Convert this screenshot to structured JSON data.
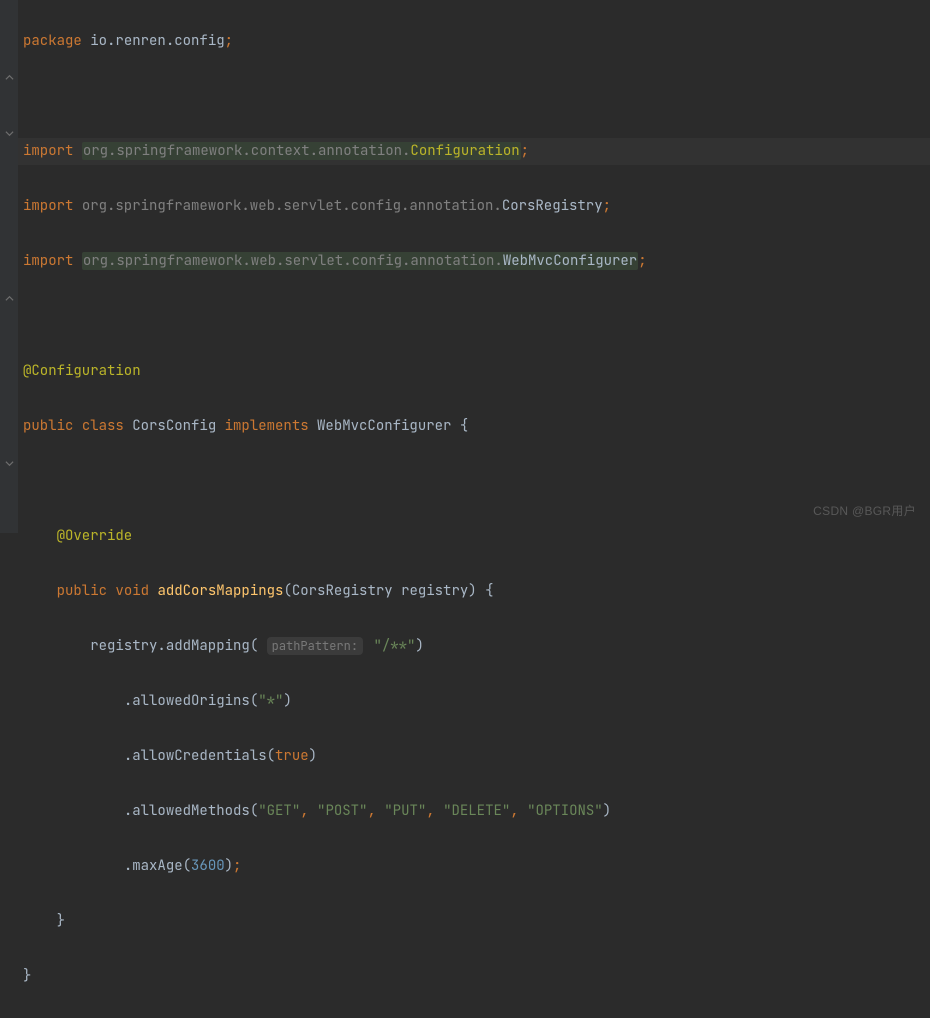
{
  "code": {
    "pkg_kw": "package",
    "pkg_path": "io.renren.config",
    "import_kw": "import",
    "imp1_pkg": "org.springframework.context.annotation.",
    "imp1_cls": "Configuration",
    "imp2_pkg": "org.springframework.web.servlet.config.annotation.",
    "imp2_cls": "CorsRegistry",
    "imp3_pkg": "org.springframework.web.servlet.config.annotation.",
    "imp3_cls": "WebMvcConfigurer",
    "ann_config": "@Configuration",
    "public_kw": "public",
    "class_kw": "class",
    "class_name": "CorsConfig",
    "implements_kw": "implements",
    "iface": "WebMvcConfigurer",
    "ann_override": "@Override",
    "void_kw": "void",
    "method_name": "addCorsMappings",
    "param_type": "CorsRegistry",
    "param_name": "registry",
    "reg_var": "registry",
    "addMapping": "addMapping",
    "hint_pathPattern": "pathPattern:",
    "str_all": "\"/**\"",
    "allowedOrigins": "allowedOrigins",
    "str_star": "\"*\"",
    "allowCredentials": "allowCredentials",
    "true_lit": "true",
    "allowedMethods": "allowedMethods",
    "str_get": "\"GET\"",
    "str_post": "\"POST\"",
    "str_put": "\"PUT\"",
    "str_delete": "\"DELETE\"",
    "str_options": "\"OPTIONS\"",
    "maxAge": "maxAge",
    "num_3600": "3600"
  },
  "watermark": "CSDN @BGR用户"
}
